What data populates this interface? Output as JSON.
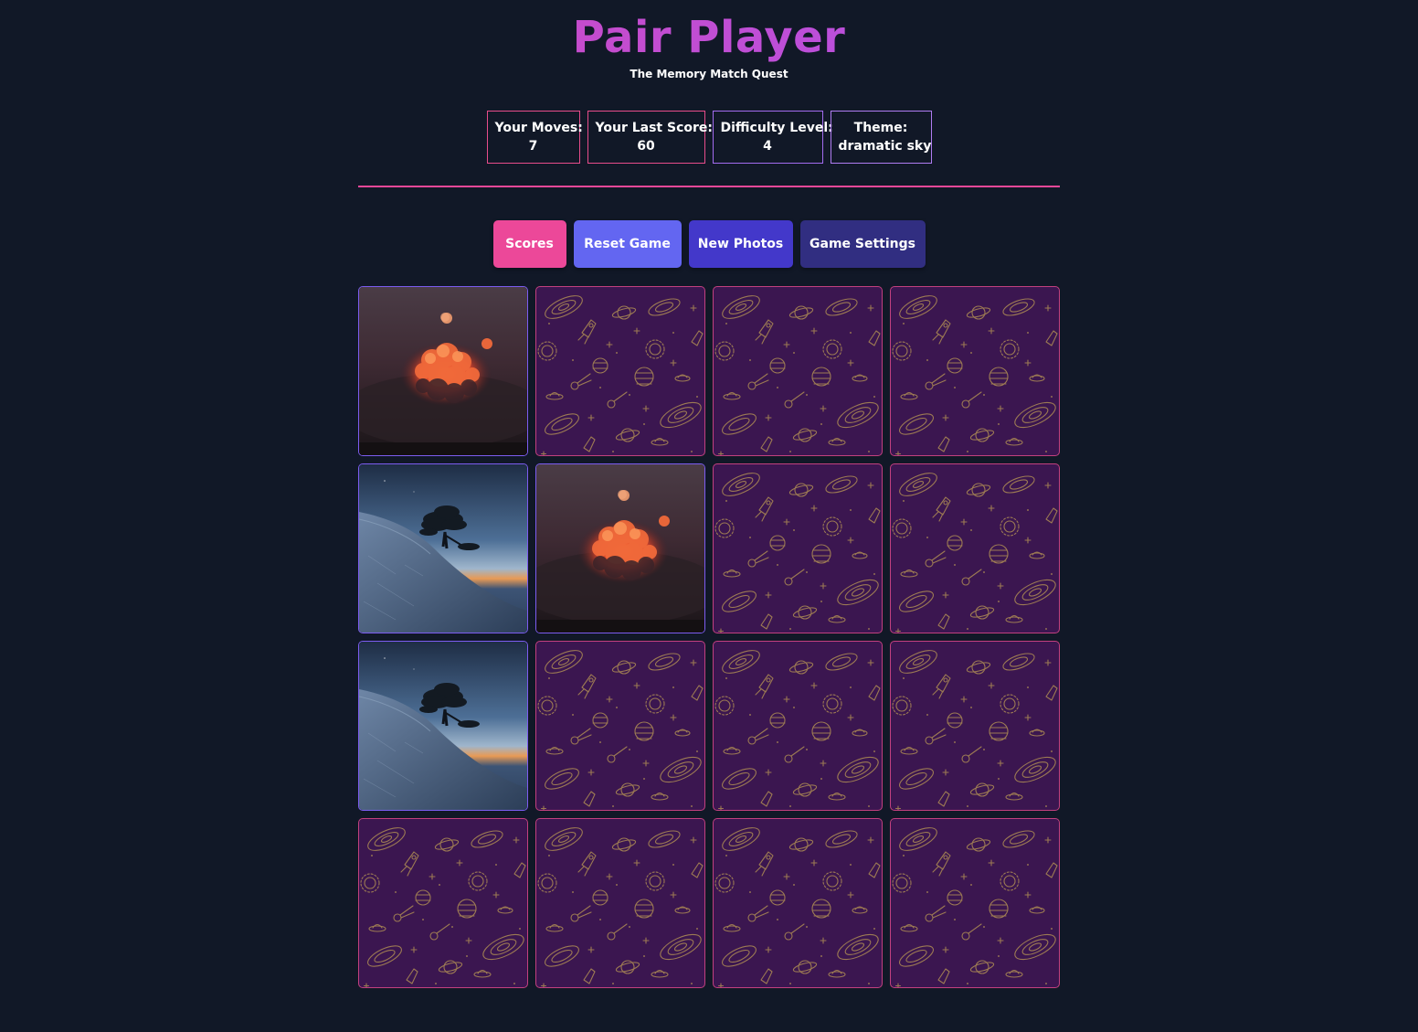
{
  "header": {
    "title": "Pair Player",
    "subtitle": "The Memory Match Quest"
  },
  "stats": {
    "moves": {
      "label": "Your Moves:",
      "value": "7"
    },
    "last_score": {
      "label": "Your Last Score:",
      "value": "60"
    },
    "difficulty": {
      "label": "Difficulty Level:",
      "value": "4"
    },
    "theme": {
      "label": "Theme:",
      "value": "dramatic sky"
    }
  },
  "buttons": {
    "scores": "Scores",
    "reset": "Reset Game",
    "new_photos": "New Photos",
    "settings": "Game Settings"
  },
  "colors": {
    "background": "#111827",
    "accent_pink": "#ec4899",
    "accent_indigo": "#6366f1",
    "card_back": "#3b1650",
    "pattern_gold": "#b08a52"
  },
  "board": {
    "columns": 4,
    "rows": 4,
    "cards": [
      {
        "state": "flipped",
        "image": "sunset-cloud-moon"
      },
      {
        "state": "hidden",
        "image": "space-doodle-pattern"
      },
      {
        "state": "hidden",
        "image": "space-doodle-pattern"
      },
      {
        "state": "hidden",
        "image": "space-doodle-pattern"
      },
      {
        "state": "flipped",
        "image": "lone-tree-snowy-hill"
      },
      {
        "state": "flipped",
        "image": "sunset-cloud-moon"
      },
      {
        "state": "hidden",
        "image": "space-doodle-pattern"
      },
      {
        "state": "hidden",
        "image": "space-doodle-pattern"
      },
      {
        "state": "flipped",
        "image": "lone-tree-snowy-hill"
      },
      {
        "state": "hidden",
        "image": "space-doodle-pattern"
      },
      {
        "state": "hidden",
        "image": "space-doodle-pattern"
      },
      {
        "state": "hidden",
        "image": "space-doodle-pattern"
      },
      {
        "state": "hidden",
        "image": "space-doodle-pattern"
      },
      {
        "state": "hidden",
        "image": "space-doodle-pattern"
      },
      {
        "state": "hidden",
        "image": "space-doodle-pattern"
      },
      {
        "state": "hidden",
        "image": "space-doodle-pattern"
      }
    ]
  }
}
